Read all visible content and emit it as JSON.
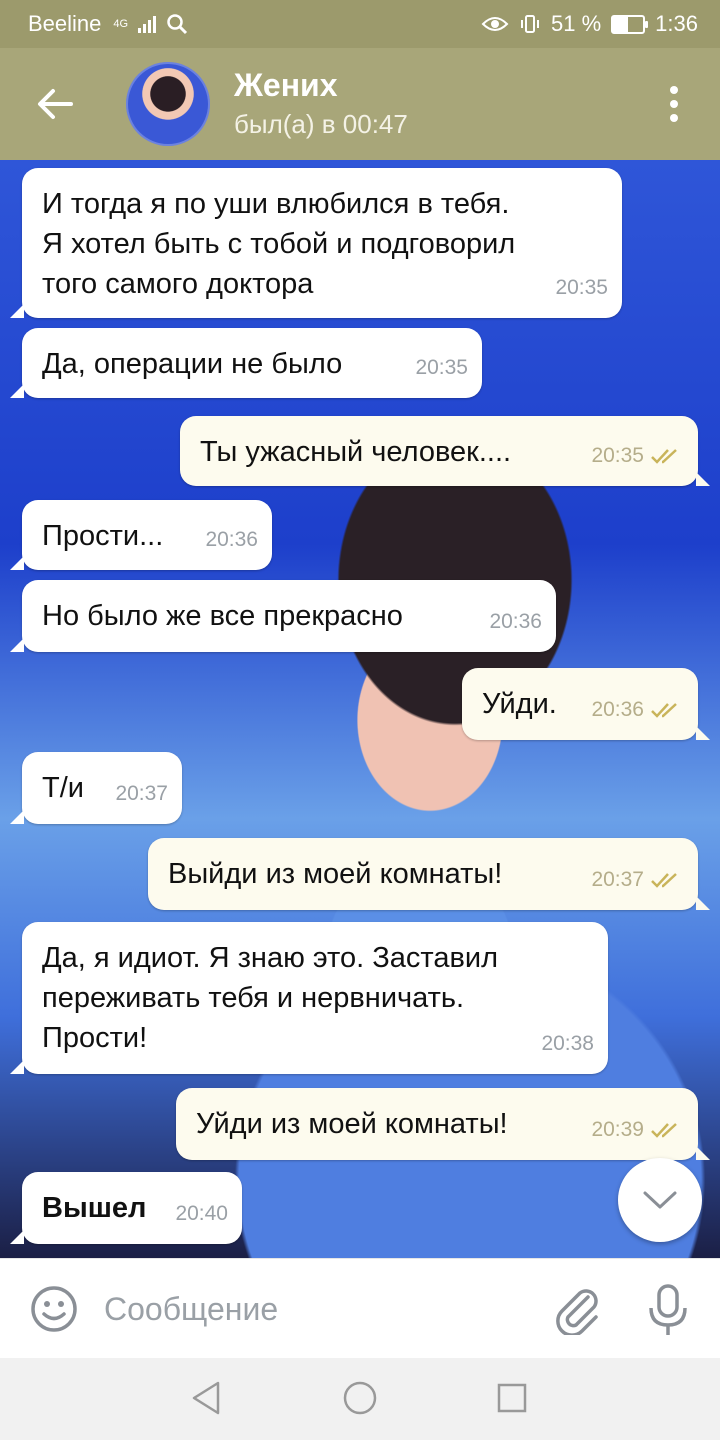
{
  "status_bar": {
    "carrier": "Beeline",
    "network": "4G",
    "battery_percent": "51 %",
    "battery_level": 0.51,
    "time": "1:36"
  },
  "header": {
    "contact_name": "Жених",
    "last_seen": "был(а) в 00:47"
  },
  "messages": [
    {
      "dir": "in",
      "text": "И тогда я по уши влюбился в тебя.\nЯ хотел быть с тобой и подговорил\nтого самого доктора",
      "time": "20:35"
    },
    {
      "dir": "in",
      "text": "Да, операции не было",
      "time": "20:35"
    },
    {
      "dir": "out",
      "text": "Ты ужасный человек....",
      "time": "20:35",
      "read": true
    },
    {
      "dir": "in",
      "text": "Прости...",
      "time": "20:36"
    },
    {
      "dir": "in",
      "text": "Но было же все прекрасно",
      "time": "20:36"
    },
    {
      "dir": "out",
      "text": "Уйди.",
      "time": "20:36",
      "read": true
    },
    {
      "dir": "in",
      "text": "Т/и",
      "time": "20:37"
    },
    {
      "dir": "out",
      "text": "Выйди из моей комнаты!",
      "time": "20:37",
      "read": true
    },
    {
      "dir": "in",
      "text": "Да, я идиот. Я знаю это. Заставил\nпереживать тебя и нервничать.\nПрости!",
      "time": "20:38"
    },
    {
      "dir": "out",
      "text": "Уйди из моей комнаты!",
      "time": "20:39",
      "read": true
    },
    {
      "dir": "in",
      "text": "Вышел",
      "time": "20:40",
      "bold": true
    }
  ],
  "input": {
    "placeholder": "Сообщение"
  },
  "colors": {
    "header_bg": "#a8a679",
    "statusbar_bg": "#9c9a6c",
    "incoming_bubble": "#ffffff",
    "outgoing_bubble": "#fdfbee",
    "read_tick": "#c9b45a"
  },
  "icons": [
    "back-arrow-icon",
    "menu-dots-icon",
    "double-check-icon",
    "chevron-down-icon",
    "emoji-icon",
    "paperclip-icon",
    "microphone-icon",
    "nav-back-icon",
    "nav-home-icon",
    "nav-recents-icon"
  ]
}
